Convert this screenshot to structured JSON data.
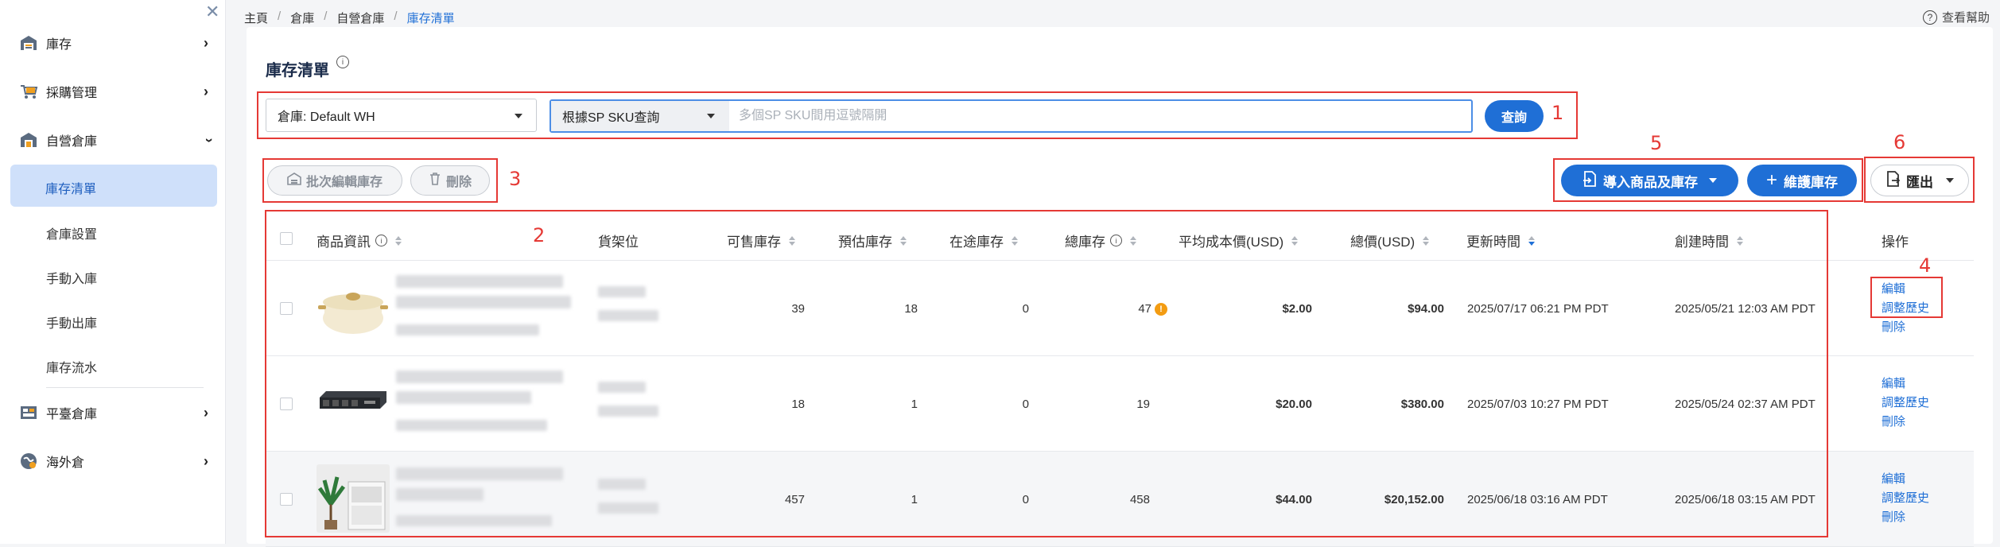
{
  "sidebar": {
    "items": [
      {
        "label": "庫存"
      },
      {
        "label": "採購管理"
      },
      {
        "label": "自營倉庫"
      },
      {
        "label": "平臺倉庫"
      },
      {
        "label": "海外倉"
      }
    ],
    "sub_items": [
      "庫存清單",
      "倉庫設置",
      "手動入庫",
      "手動出庫",
      "庫存流水"
    ]
  },
  "breadcrumb": [
    "主頁",
    "倉庫",
    "自營倉庫",
    "庫存清單"
  ],
  "help_label": "查看幫助",
  "page_title": "庫存清單",
  "filters": {
    "warehouse": "倉庫: Default WH",
    "search_type": "根據SP SKU查詢",
    "search_placeholder": "多個SP SKU間用逗號隔開",
    "query_label": "查詢"
  },
  "toolbar": {
    "batch_edit": "批次編輯庫存",
    "delete": "刪除",
    "import": "導入商品及庫存",
    "maintain": "維護庫存",
    "export": "匯出"
  },
  "annotations": [
    "1",
    "2",
    "3",
    "4",
    "5",
    "6"
  ],
  "table": {
    "columns": [
      "商品資訊",
      "貨架位",
      "可售庫存",
      "預估庫存",
      "在途庫存",
      "總庫存",
      "平均成本價(USD)",
      "總價(USD)",
      "更新時間",
      "創建時間",
      "操作"
    ],
    "rows": [
      {
        "sellable": "39",
        "estimated": "18",
        "transit": "0",
        "total": "47",
        "avg_cost": "$2.00",
        "total_value": "$94.00",
        "updated": "2025/07/17 06:21 PM PDT",
        "created": "2025/05/21 12:03 AM PDT"
      },
      {
        "sellable": "18",
        "estimated": "1",
        "transit": "0",
        "total": "19",
        "avg_cost": "$20.00",
        "total_value": "$380.00",
        "updated": "2025/07/03 10:27 PM PDT",
        "created": "2025/05/24 02:37 AM PDT"
      },
      {
        "sellable": "457",
        "estimated": "1",
        "transit": "0",
        "total": "458",
        "avg_cost": "$44.00",
        "total_value": "$20,152.00",
        "updated": "2025/06/18 03:16 AM PDT",
        "created": "2025/06/18 03:15 AM PDT"
      }
    ],
    "actions": {
      "edit": "編輯",
      "history": "調整歷史",
      "delete": "刪除"
    }
  },
  "colors": {
    "primary": "#1f6fd6",
    "annotation": "#e53935",
    "warning": "#f39c12"
  }
}
